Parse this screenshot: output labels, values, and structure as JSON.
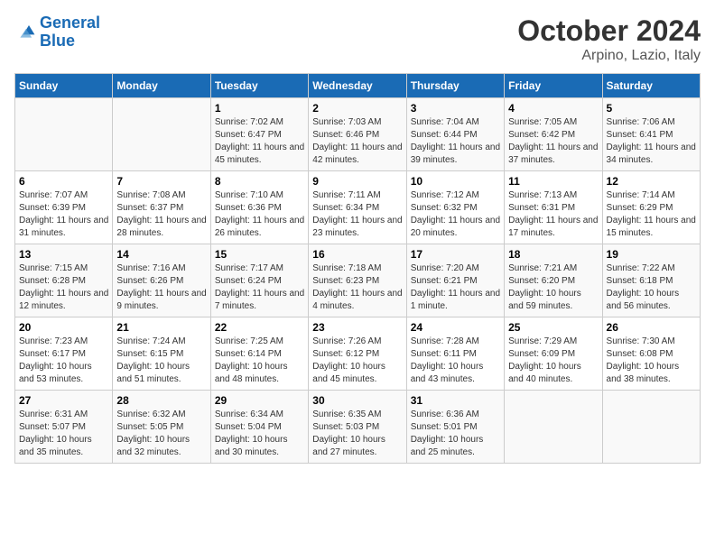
{
  "header": {
    "logo_line1": "General",
    "logo_line2": "Blue",
    "month": "October 2024",
    "location": "Arpino, Lazio, Italy"
  },
  "weekdays": [
    "Sunday",
    "Monday",
    "Tuesday",
    "Wednesday",
    "Thursday",
    "Friday",
    "Saturday"
  ],
  "weeks": [
    [
      null,
      null,
      {
        "day": "1",
        "sunrise": "7:02 AM",
        "sunset": "6:47 PM",
        "daylight": "11 hours and 45 minutes."
      },
      {
        "day": "2",
        "sunrise": "7:03 AM",
        "sunset": "6:46 PM",
        "daylight": "11 hours and 42 minutes."
      },
      {
        "day": "3",
        "sunrise": "7:04 AM",
        "sunset": "6:44 PM",
        "daylight": "11 hours and 39 minutes."
      },
      {
        "day": "4",
        "sunrise": "7:05 AM",
        "sunset": "6:42 PM",
        "daylight": "11 hours and 37 minutes."
      },
      {
        "day": "5",
        "sunrise": "7:06 AM",
        "sunset": "6:41 PM",
        "daylight": "11 hours and 34 minutes."
      }
    ],
    [
      {
        "day": "6",
        "sunrise": "7:07 AM",
        "sunset": "6:39 PM",
        "daylight": "11 hours and 31 minutes."
      },
      {
        "day": "7",
        "sunrise": "7:08 AM",
        "sunset": "6:37 PM",
        "daylight": "11 hours and 28 minutes."
      },
      {
        "day": "8",
        "sunrise": "7:10 AM",
        "sunset": "6:36 PM",
        "daylight": "11 hours and 26 minutes."
      },
      {
        "day": "9",
        "sunrise": "7:11 AM",
        "sunset": "6:34 PM",
        "daylight": "11 hours and 23 minutes."
      },
      {
        "day": "10",
        "sunrise": "7:12 AM",
        "sunset": "6:32 PM",
        "daylight": "11 hours and 20 minutes."
      },
      {
        "day": "11",
        "sunrise": "7:13 AM",
        "sunset": "6:31 PM",
        "daylight": "11 hours and 17 minutes."
      },
      {
        "day": "12",
        "sunrise": "7:14 AM",
        "sunset": "6:29 PM",
        "daylight": "11 hours and 15 minutes."
      }
    ],
    [
      {
        "day": "13",
        "sunrise": "7:15 AM",
        "sunset": "6:28 PM",
        "daylight": "11 hours and 12 minutes."
      },
      {
        "day": "14",
        "sunrise": "7:16 AM",
        "sunset": "6:26 PM",
        "daylight": "11 hours and 9 minutes."
      },
      {
        "day": "15",
        "sunrise": "7:17 AM",
        "sunset": "6:24 PM",
        "daylight": "11 hours and 7 minutes."
      },
      {
        "day": "16",
        "sunrise": "7:18 AM",
        "sunset": "6:23 PM",
        "daylight": "11 hours and 4 minutes."
      },
      {
        "day": "17",
        "sunrise": "7:20 AM",
        "sunset": "6:21 PM",
        "daylight": "11 hours and 1 minute."
      },
      {
        "day": "18",
        "sunrise": "7:21 AM",
        "sunset": "6:20 PM",
        "daylight": "10 hours and 59 minutes."
      },
      {
        "day": "19",
        "sunrise": "7:22 AM",
        "sunset": "6:18 PM",
        "daylight": "10 hours and 56 minutes."
      }
    ],
    [
      {
        "day": "20",
        "sunrise": "7:23 AM",
        "sunset": "6:17 PM",
        "daylight": "10 hours and 53 minutes."
      },
      {
        "day": "21",
        "sunrise": "7:24 AM",
        "sunset": "6:15 PM",
        "daylight": "10 hours and 51 minutes."
      },
      {
        "day": "22",
        "sunrise": "7:25 AM",
        "sunset": "6:14 PM",
        "daylight": "10 hours and 48 minutes."
      },
      {
        "day": "23",
        "sunrise": "7:26 AM",
        "sunset": "6:12 PM",
        "daylight": "10 hours and 45 minutes."
      },
      {
        "day": "24",
        "sunrise": "7:28 AM",
        "sunset": "6:11 PM",
        "daylight": "10 hours and 43 minutes."
      },
      {
        "day": "25",
        "sunrise": "7:29 AM",
        "sunset": "6:09 PM",
        "daylight": "10 hours and 40 minutes."
      },
      {
        "day": "26",
        "sunrise": "7:30 AM",
        "sunset": "6:08 PM",
        "daylight": "10 hours and 38 minutes."
      }
    ],
    [
      {
        "day": "27",
        "sunrise": "6:31 AM",
        "sunset": "5:07 PM",
        "daylight": "10 hours and 35 minutes."
      },
      {
        "day": "28",
        "sunrise": "6:32 AM",
        "sunset": "5:05 PM",
        "daylight": "10 hours and 32 minutes."
      },
      {
        "day": "29",
        "sunrise": "6:34 AM",
        "sunset": "5:04 PM",
        "daylight": "10 hours and 30 minutes."
      },
      {
        "day": "30",
        "sunrise": "6:35 AM",
        "sunset": "5:03 PM",
        "daylight": "10 hours and 27 minutes."
      },
      {
        "day": "31",
        "sunrise": "6:36 AM",
        "sunset": "5:01 PM",
        "daylight": "10 hours and 25 minutes."
      },
      null,
      null
    ]
  ]
}
